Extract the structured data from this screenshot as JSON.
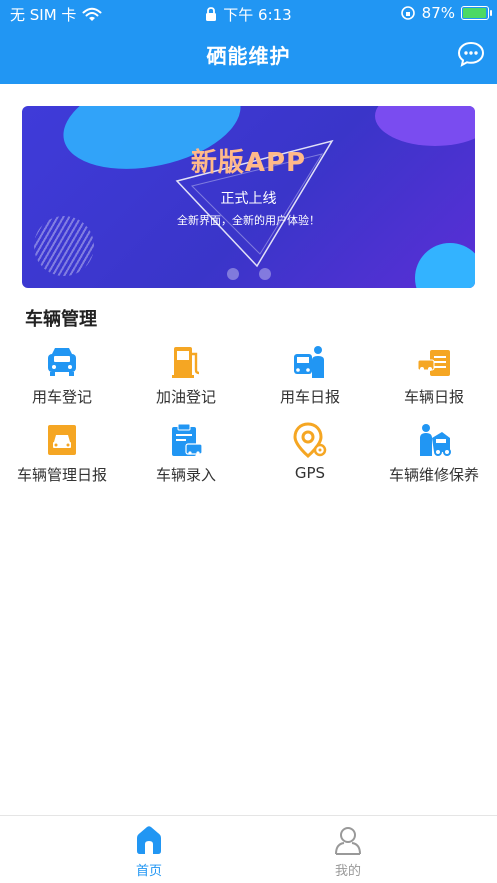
{
  "status_bar": {
    "carrier": "无 SIM 卡",
    "time": "下午 6:13",
    "battery": "87%",
    "battery_level": 0.87
  },
  "header": {
    "title": "硒能维护",
    "message_icon": "chat-bubble-icon"
  },
  "banner": {
    "title": "新版APP",
    "subtitle": "正式上线",
    "tagline": "全新界面，全新的用户体验！",
    "slides": 2
  },
  "section": {
    "title": "车辆管理"
  },
  "menu": [
    {
      "label": "用车登记",
      "icon": "car-icon",
      "color": "#2196f3"
    },
    {
      "label": "加油登记",
      "icon": "fuel-pump-icon",
      "color": "#f5a623"
    },
    {
      "label": "用车日报",
      "icon": "bus-person-icon",
      "color": "#2196f3"
    },
    {
      "label": "车辆日报",
      "icon": "car-report-icon",
      "color": "#f5a623"
    },
    {
      "label": "车辆管理日报",
      "icon": "vehicle-doc-icon",
      "color": "#f5a623"
    },
    {
      "label": "车辆录入",
      "icon": "clipboard-car-icon",
      "color": "#2196f3"
    },
    {
      "label": "GPS",
      "icon": "gps-pin-icon",
      "color": "#f5a623"
    },
    {
      "label": "车辆维修保养",
      "icon": "mechanic-icon",
      "color": "#2196f3"
    }
  ],
  "tabbar": {
    "home": "首页",
    "mine": "我的",
    "active_color": "#2196f3",
    "inactive_color": "#999999"
  }
}
